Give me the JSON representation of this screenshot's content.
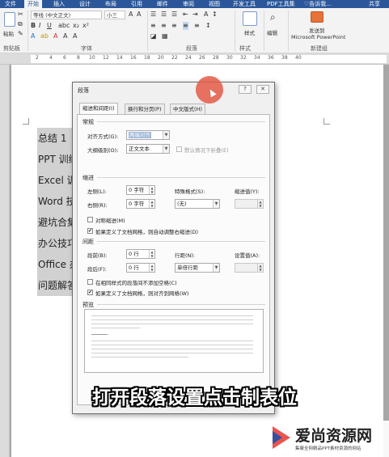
{
  "ribbon": {
    "tabs": [
      "文件",
      "开始",
      "插入",
      "设计",
      "布局",
      "引用",
      "邮件",
      "审阅",
      "视图",
      "开发工具",
      "PDF工具集",
      "♡告诉我..."
    ],
    "user": "共享",
    "font_name": "等线 (中文正文)",
    "font_size": "小三",
    "group_clipboard": "剪贴板",
    "group_font": "字体",
    "group_paragraph": "段落",
    "group_style": "样式",
    "group_new": "新建组",
    "paste_label": "粘贴",
    "style_label": "样式",
    "edit_label": "编辑",
    "send_label": "发送到",
    "send_target": "Microsoft PowerPoint"
  },
  "ruler": {
    "numbers": [
      "2",
      "4",
      "6",
      "8",
      "10",
      "12",
      "14",
      "16",
      "18",
      "20",
      "22",
      "24",
      "26",
      "28",
      "30",
      "32",
      "34",
      "36",
      "38",
      "40"
    ]
  },
  "document": {
    "lines": [
      "总结 1",
      "PPT 训练营",
      "Excel 训练营",
      "Word 技巧",
      "避坑合集",
      "办公技巧失",
      "Office 办公",
      "问题解答"
    ]
  },
  "dialog": {
    "title": "段落",
    "help_btn": "?",
    "close_btn": "✕",
    "tabs": [
      "缩进和间距(I)",
      "换行和分页(P)",
      "中文版式(H)"
    ],
    "general": {
      "heading": "常规",
      "alignment_label": "对齐方式(G):",
      "alignment_value": "两端对齐",
      "outline_label": "大纲级别(O):",
      "outline_value": "正文文本",
      "collapse_label": "默认情况下折叠(E)"
    },
    "indent": {
      "heading": "缩进",
      "left_label": "左侧(L):",
      "left_value": "0 字符",
      "right_label": "右侧(R):",
      "right_value": "0 字符",
      "special_label": "特殊格式(S):",
      "special_value": "(无)",
      "by_label": "缩进值(Y):",
      "mirror_label": "对称缩进(M)",
      "grid_label": "如果定义了文档网格，则自动调整右缩进(D)"
    },
    "spacing": {
      "heading": "间距",
      "before_label": "段前(B):",
      "before_value": "0 行",
      "after_label": "段后(F):",
      "after_value": "0 行",
      "line_label": "行距(N):",
      "line_value": "单倍行距",
      "at_label": "设置值(A):",
      "nospace_label": "在相同样式的段落间不添加空格(C)",
      "snap_label": "如果定义了文档网格，则对齐到网格(W)"
    },
    "preview": {
      "heading": "预览"
    }
  },
  "caption": "打开段落设置点击制表位",
  "watermark": {
    "title": "爱尚资源网",
    "subtitle": "集聚全网精品PPT素材资源的网站"
  },
  "colors": {
    "ribbon_blue": "#2b579a",
    "selection_gray": "#d1d1d1",
    "cursor_red": "#e45a46"
  }
}
